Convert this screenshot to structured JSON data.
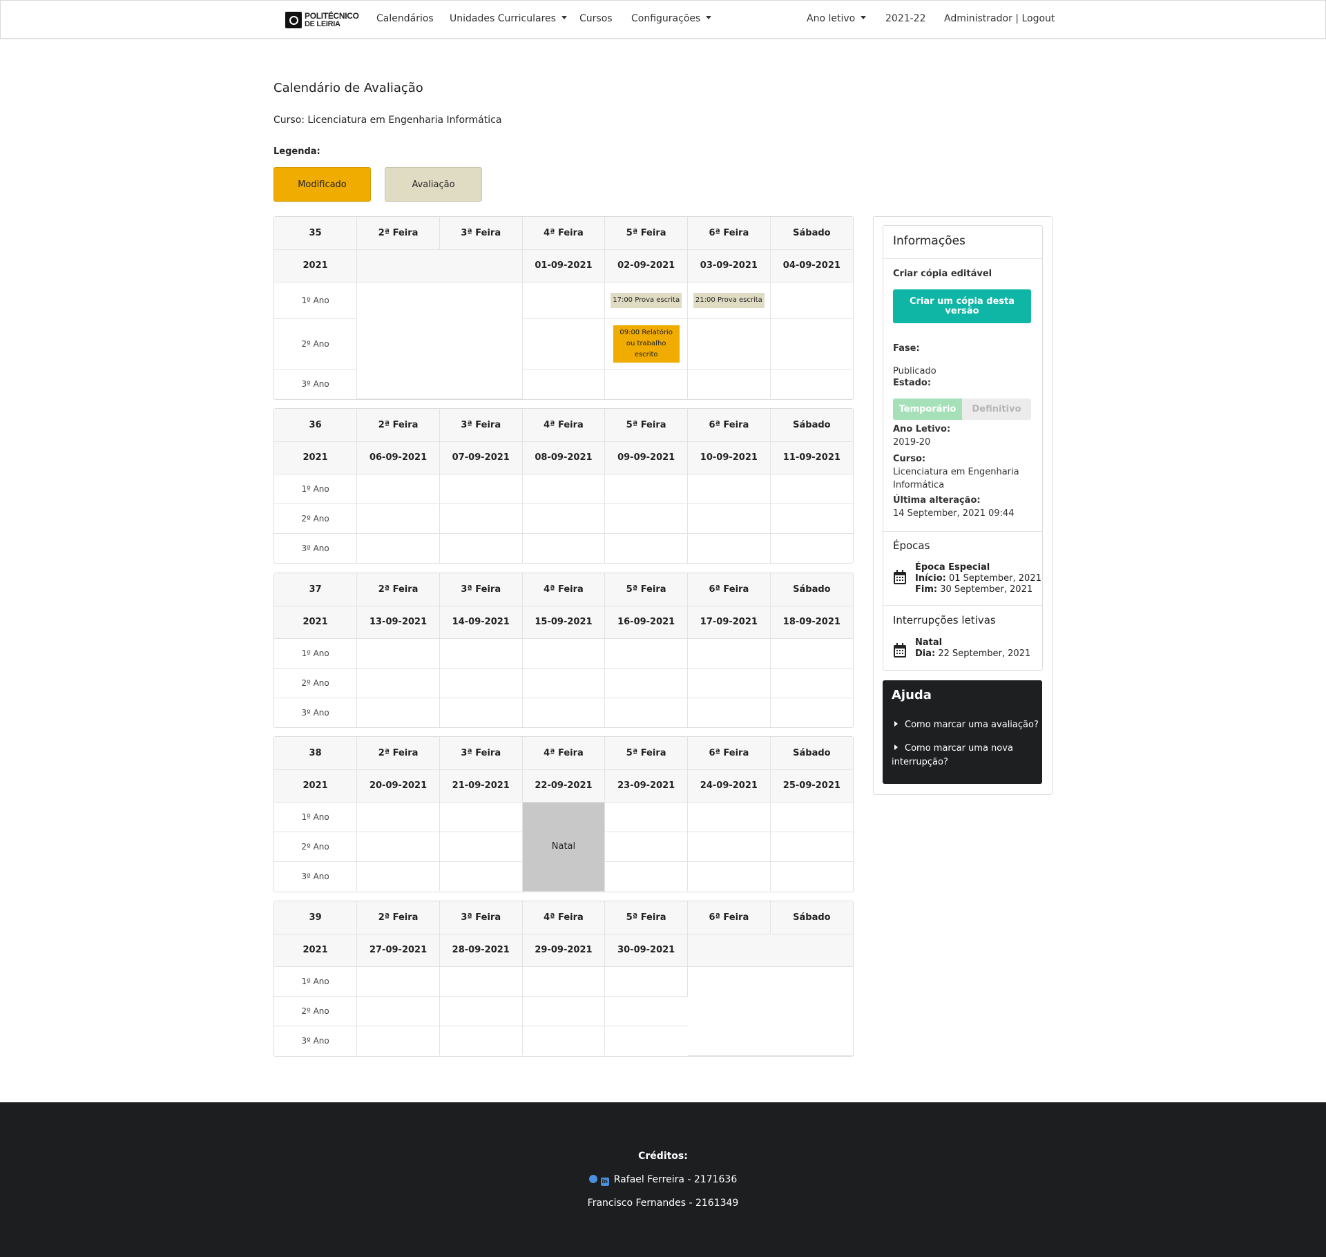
{
  "nav": {
    "logo_line1": "POLITÉCNICO",
    "logo_line2": "DE LEIRIA",
    "calendarios": "Calendários",
    "unidades": "Unidades Curriculares",
    "cursos": "Cursos",
    "config": "Configurações",
    "ano_letivo": "Ano letivo",
    "year": "2021-22",
    "admin": "Administrador | Logout"
  },
  "page": {
    "title": "Calendário de Avaliação",
    "course": "Curso: Licenciatura em Engenharia Informática",
    "legend_label": "Legenda:",
    "legend_modificado": "Modificado",
    "legend_avaliacao": "Avaliação"
  },
  "days": [
    "2ª Feira",
    "3ª Feira",
    "4ª Feira",
    "5ª Feira",
    "6ª Feira",
    "Sábado"
  ],
  "rows": [
    "1º Ano",
    "2º Ano",
    "3º Ano"
  ],
  "weeks": [
    {
      "num": "35",
      "year": "2021",
      "dates": [
        "",
        "",
        "01-09-2021",
        "02-09-2021",
        "03-09-2021",
        "04-09-2021"
      ]
    },
    {
      "num": "36",
      "year": "2021",
      "dates": [
        "06-09-2021",
        "07-09-2021",
        "08-09-2021",
        "09-09-2021",
        "10-09-2021",
        "11-09-2021"
      ]
    },
    {
      "num": "37",
      "year": "2021",
      "dates": [
        "13-09-2021",
        "14-09-2021",
        "15-09-2021",
        "16-09-2021",
        "17-09-2021",
        "18-09-2021"
      ]
    },
    {
      "num": "38",
      "year": "2021",
      "dates": [
        "20-09-2021",
        "21-09-2021",
        "22-09-2021",
        "23-09-2021",
        "24-09-2021",
        "25-09-2021"
      ]
    },
    {
      "num": "39",
      "year": "2021",
      "dates": [
        "27-09-2021",
        "28-09-2021",
        "29-09-2021",
        "30-09-2021",
        "",
        ""
      ]
    }
  ],
  "events": {
    "w35_thu_1": "17:00 Prova escrita",
    "w35_fri_1": "21:00 Prova escrita",
    "w35_thu_2": "09:00 Relatório ou trabalho escrito",
    "w38_natal": "Natal"
  },
  "colors": {
    "modificado": "#f0ac00",
    "avaliacao": "#e0dcc4",
    "interrupcao": "#c8c8c8",
    "copy_button": "#0fb5a5"
  },
  "info": {
    "title": "Informações",
    "copy_label": "Criar cópia editável",
    "copy_button": "Criar um cópia desta versão",
    "fase_label": "Fase:",
    "fase_value": "Publicado",
    "estado_label": "Estado:",
    "seg_temp": "Temporário",
    "seg_def": "Definitivo",
    "ano_label": "Ano Letivo:",
    "ano_value": "2019-20",
    "curso_label": "Curso:",
    "curso_value": "Licenciatura em Engenharia Informática",
    "alt_label": "Última alteração:",
    "alt_value": "14 September, 2021 09:44",
    "epocas_title": "Épocas",
    "epoca_name": "Época Especial",
    "epoca_inicio_label": "Início:",
    "epoca_inicio": "01 September, 2021",
    "epoca_fim_label": "Fim:",
    "epoca_fim": "30 September, 2021",
    "interr_title": "Interrupções letivas",
    "interr_name": "Natal",
    "interr_dia_label": "Dia:",
    "interr_dia": "22 September, 2021"
  },
  "help": {
    "title": "Ajuda",
    "link1": "Como marcar uma avaliação?",
    "link2a": "Como marcar uma nova",
    "link2b": "interrupção?"
  },
  "footer": {
    "creditos": "Créditos:",
    "person1": "Rafael Ferreira - 2171636",
    "person2": "Francisco Fernandes - 2161349"
  }
}
